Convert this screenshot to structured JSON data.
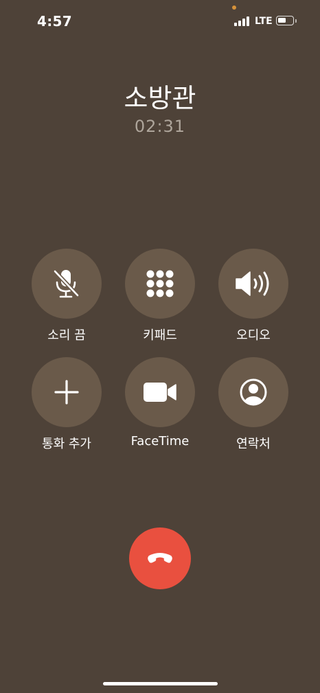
{
  "status_bar": {
    "time": "4:57",
    "network": "LTE",
    "signal_bars": 4,
    "battery_level": 0.6
  },
  "call": {
    "caller_name": "소방관",
    "duration": "02:31"
  },
  "controls": [
    {
      "label": "소리 끔",
      "icon": "mute-microphone-icon"
    },
    {
      "label": "키패드",
      "icon": "keypad-icon"
    },
    {
      "label": "오디오",
      "icon": "speaker-icon"
    },
    {
      "label": "통화 추가",
      "icon": "plus-icon"
    },
    {
      "label": "FaceTime",
      "icon": "video-camera-icon"
    },
    {
      "label": "연락처",
      "icon": "contact-person-icon"
    }
  ],
  "end_call": {
    "icon": "phone-hangup-icon"
  },
  "colors": {
    "background": "#4e4238",
    "control_circle": "#6a5a4a",
    "end_call": "#e9503f",
    "duration_text": "#aea59b",
    "camera_indicator": "#d6923a"
  }
}
